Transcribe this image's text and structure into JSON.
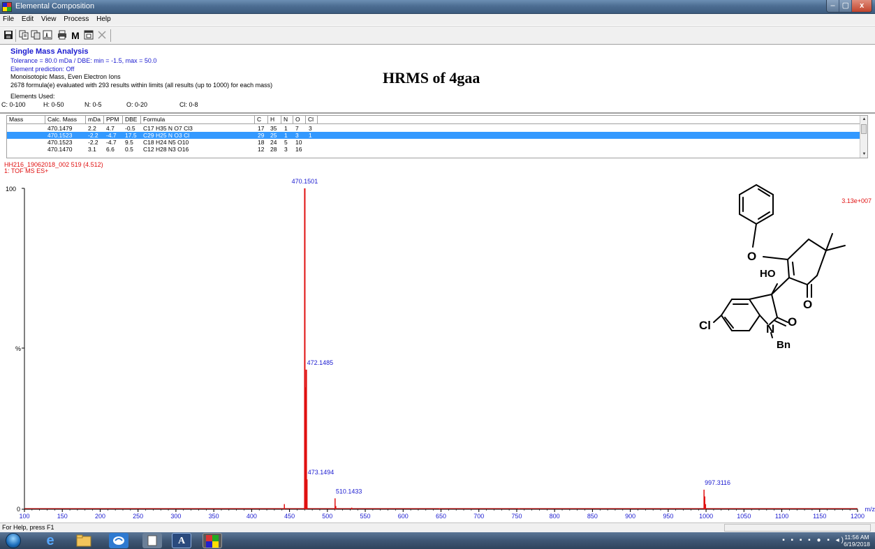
{
  "window": {
    "title": "Elemental Composition",
    "controls": {
      "minimize": "–",
      "maximize": "▢",
      "close": "x"
    }
  },
  "menu": [
    "File",
    "Edit",
    "View",
    "Process",
    "Help"
  ],
  "toolbar": {
    "icons": [
      "save-icon",
      "copy-icon",
      "copy-list-icon",
      "copy-spectrum-icon",
      "print-icon",
      "m-button-icon",
      "window-icon",
      "close-icon"
    ],
    "m_label": "M"
  },
  "analysis": {
    "title": "Single Mass Analysis",
    "tolerance": "Tolerance = 80.0 mDa   /   DBE: min = -1.5, max = 50.0",
    "element_prediction": "Element prediction: Off",
    "ion_mode": "Monoisotopic Mass, Even Electron Ions",
    "summary": "2678 formula(e) evaluated with 293 results within limits (all results (up to 1000) for each mass)",
    "elements_used_label": "Elements Used:",
    "elements": [
      "C: 0-100",
      "H: 0-50",
      "N: 0-5",
      "O: 0-20",
      "Cl: 0-8"
    ]
  },
  "annotation": {
    "heading": "HRMS of 4gaa"
  },
  "table": {
    "columns": [
      "Mass",
      "Calc. Mass",
      "mDa",
      "PPM",
      "DBE",
      "Formula",
      "C",
      "H",
      "N",
      "O",
      "Cl"
    ],
    "rows": [
      {
        "mass": "",
        "calc": "470.1479",
        "mda": "2.2",
        "ppm": "4.7",
        "dbe": "-0.5",
        "formula": "C17  H35  N  O7  Cl3",
        "c": "17",
        "h": "35",
        "n": "1",
        "o": "7",
        "cl": "3",
        "selected": false
      },
      {
        "mass": "",
        "calc": "470.1523",
        "mda": "-2.2",
        "ppm": "-4.7",
        "dbe": "17.5",
        "formula": "C29  H25  N  O3  Cl",
        "c": "29",
        "h": "25",
        "n": "1",
        "o": "3",
        "cl": "1",
        "selected": true
      },
      {
        "mass": "",
        "calc": "470.1523",
        "mda": "-2.2",
        "ppm": "-4.7",
        "dbe": "9.5",
        "formula": "C18  H24  N5  O10",
        "c": "18",
        "h": "24",
        "n": "5",
        "o": "10",
        "cl": "",
        "selected": false
      },
      {
        "mass": "",
        "calc": "470.1470",
        "mda": "3.1",
        "ppm": "6.6",
        "dbe": "0.5",
        "formula": "C12  H28  N3  O16",
        "c": "12",
        "h": "28",
        "n": "3",
        "o": "16",
        "cl": "",
        "selected": false
      }
    ]
  },
  "spectrum": {
    "sample": "HH216_19062018_002 519 (4.512)",
    "function": "1: TOF MS ES+",
    "intensity_max": "3.13e+007",
    "y_axis": {
      "top_label": "100",
      "mid_label": "%",
      "bottom_label": "0"
    },
    "x_axis": {
      "unit": "m/z",
      "min": 100,
      "max": 1200,
      "ticks": [
        100,
        150,
        200,
        250,
        300,
        350,
        400,
        450,
        500,
        550,
        600,
        650,
        700,
        750,
        800,
        850,
        900,
        950,
        1000,
        1050,
        1100,
        1150,
        1200
      ]
    },
    "peaks": [
      {
        "mz": 470.1501,
        "intensity": 100,
        "label": "470.1501"
      },
      {
        "mz": 471.153,
        "intensity": 38,
        "label": ""
      },
      {
        "mz": 472.1485,
        "intensity": 43.5,
        "label": "472.1485"
      },
      {
        "mz": 473.1494,
        "intensity": 9.3,
        "label": "473.1494"
      },
      {
        "mz": 443.2,
        "intensity": 1.6,
        "label": ""
      },
      {
        "mz": 510.1433,
        "intensity": 3.4,
        "label": "510.1433"
      },
      {
        "mz": 511.1,
        "intensity": 1.0,
        "label": ""
      },
      {
        "mz": 997.3116,
        "intensity": 6.1,
        "label": "997.3116"
      },
      {
        "mz": 998.3,
        "intensity": 4.0,
        "label": ""
      },
      {
        "mz": 999.3,
        "intensity": 1.6,
        "label": ""
      },
      {
        "mz": 532.1,
        "intensity": 0.5,
        "label": ""
      },
      {
        "mz": 648.0,
        "intensity": 0.3,
        "label": ""
      },
      {
        "mz": 753.0,
        "intensity": 0.3,
        "label": ""
      }
    ],
    "color": "#e01010"
  },
  "molecule": {
    "atoms": {
      "o_ether": "O",
      "ho": "HO",
      "o_ketone": "O",
      "cl": "Cl",
      "n": "N",
      "o_amide": "O",
      "bn": "Bn"
    }
  },
  "status": {
    "text": "For Help, press F1"
  },
  "taskbar": {
    "clock_time": "11:56 AM",
    "clock_date": "6/19/2018",
    "a_label": "A"
  }
}
